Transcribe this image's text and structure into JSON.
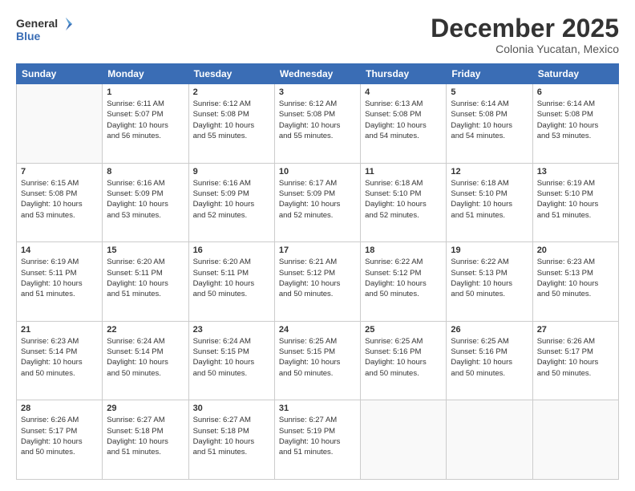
{
  "header": {
    "logo_line1": "General",
    "logo_line2": "Blue",
    "month": "December 2025",
    "location": "Colonia Yucatan, Mexico"
  },
  "weekdays": [
    "Sunday",
    "Monday",
    "Tuesday",
    "Wednesday",
    "Thursday",
    "Friday",
    "Saturday"
  ],
  "weeks": [
    [
      {
        "day": "",
        "info": ""
      },
      {
        "day": "1",
        "info": "Sunrise: 6:11 AM\nSunset: 5:07 PM\nDaylight: 10 hours\nand 56 minutes."
      },
      {
        "day": "2",
        "info": "Sunrise: 6:12 AM\nSunset: 5:08 PM\nDaylight: 10 hours\nand 55 minutes."
      },
      {
        "day": "3",
        "info": "Sunrise: 6:12 AM\nSunset: 5:08 PM\nDaylight: 10 hours\nand 55 minutes."
      },
      {
        "day": "4",
        "info": "Sunrise: 6:13 AM\nSunset: 5:08 PM\nDaylight: 10 hours\nand 54 minutes."
      },
      {
        "day": "5",
        "info": "Sunrise: 6:14 AM\nSunset: 5:08 PM\nDaylight: 10 hours\nand 54 minutes."
      },
      {
        "day": "6",
        "info": "Sunrise: 6:14 AM\nSunset: 5:08 PM\nDaylight: 10 hours\nand 53 minutes."
      }
    ],
    [
      {
        "day": "7",
        "info": "Sunrise: 6:15 AM\nSunset: 5:08 PM\nDaylight: 10 hours\nand 53 minutes."
      },
      {
        "day": "8",
        "info": "Sunrise: 6:16 AM\nSunset: 5:09 PM\nDaylight: 10 hours\nand 53 minutes."
      },
      {
        "day": "9",
        "info": "Sunrise: 6:16 AM\nSunset: 5:09 PM\nDaylight: 10 hours\nand 52 minutes."
      },
      {
        "day": "10",
        "info": "Sunrise: 6:17 AM\nSunset: 5:09 PM\nDaylight: 10 hours\nand 52 minutes."
      },
      {
        "day": "11",
        "info": "Sunrise: 6:18 AM\nSunset: 5:10 PM\nDaylight: 10 hours\nand 52 minutes."
      },
      {
        "day": "12",
        "info": "Sunrise: 6:18 AM\nSunset: 5:10 PM\nDaylight: 10 hours\nand 51 minutes."
      },
      {
        "day": "13",
        "info": "Sunrise: 6:19 AM\nSunset: 5:10 PM\nDaylight: 10 hours\nand 51 minutes."
      }
    ],
    [
      {
        "day": "14",
        "info": "Sunrise: 6:19 AM\nSunset: 5:11 PM\nDaylight: 10 hours\nand 51 minutes."
      },
      {
        "day": "15",
        "info": "Sunrise: 6:20 AM\nSunset: 5:11 PM\nDaylight: 10 hours\nand 51 minutes."
      },
      {
        "day": "16",
        "info": "Sunrise: 6:20 AM\nSunset: 5:11 PM\nDaylight: 10 hours\nand 50 minutes."
      },
      {
        "day": "17",
        "info": "Sunrise: 6:21 AM\nSunset: 5:12 PM\nDaylight: 10 hours\nand 50 minutes."
      },
      {
        "day": "18",
        "info": "Sunrise: 6:22 AM\nSunset: 5:12 PM\nDaylight: 10 hours\nand 50 minutes."
      },
      {
        "day": "19",
        "info": "Sunrise: 6:22 AM\nSunset: 5:13 PM\nDaylight: 10 hours\nand 50 minutes."
      },
      {
        "day": "20",
        "info": "Sunrise: 6:23 AM\nSunset: 5:13 PM\nDaylight: 10 hours\nand 50 minutes."
      }
    ],
    [
      {
        "day": "21",
        "info": "Sunrise: 6:23 AM\nSunset: 5:14 PM\nDaylight: 10 hours\nand 50 minutes."
      },
      {
        "day": "22",
        "info": "Sunrise: 6:24 AM\nSunset: 5:14 PM\nDaylight: 10 hours\nand 50 minutes."
      },
      {
        "day": "23",
        "info": "Sunrise: 6:24 AM\nSunset: 5:15 PM\nDaylight: 10 hours\nand 50 minutes."
      },
      {
        "day": "24",
        "info": "Sunrise: 6:25 AM\nSunset: 5:15 PM\nDaylight: 10 hours\nand 50 minutes."
      },
      {
        "day": "25",
        "info": "Sunrise: 6:25 AM\nSunset: 5:16 PM\nDaylight: 10 hours\nand 50 minutes."
      },
      {
        "day": "26",
        "info": "Sunrise: 6:25 AM\nSunset: 5:16 PM\nDaylight: 10 hours\nand 50 minutes."
      },
      {
        "day": "27",
        "info": "Sunrise: 6:26 AM\nSunset: 5:17 PM\nDaylight: 10 hours\nand 50 minutes."
      }
    ],
    [
      {
        "day": "28",
        "info": "Sunrise: 6:26 AM\nSunset: 5:17 PM\nDaylight: 10 hours\nand 50 minutes."
      },
      {
        "day": "29",
        "info": "Sunrise: 6:27 AM\nSunset: 5:18 PM\nDaylight: 10 hours\nand 51 minutes."
      },
      {
        "day": "30",
        "info": "Sunrise: 6:27 AM\nSunset: 5:18 PM\nDaylight: 10 hours\nand 51 minutes."
      },
      {
        "day": "31",
        "info": "Sunrise: 6:27 AM\nSunset: 5:19 PM\nDaylight: 10 hours\nand 51 minutes."
      },
      {
        "day": "",
        "info": ""
      },
      {
        "day": "",
        "info": ""
      },
      {
        "day": "",
        "info": ""
      }
    ]
  ]
}
